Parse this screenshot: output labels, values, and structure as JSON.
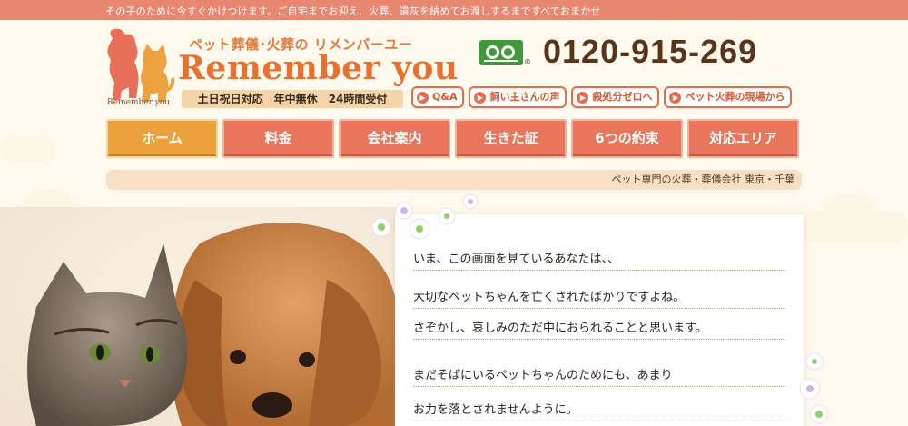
{
  "topbar": {
    "text": "その子のために今すぐかけつけます。ご自宅までお迎え、火葬、遺灰を納めてお渡しするまですべておまかせ"
  },
  "logo": {
    "caption": "Remember you",
    "tagline": "ペット葬儀･火葬の リメンバーユー",
    "brand": "Remember you",
    "hours": "土日祝日対応　年中無休　24時間受付"
  },
  "contact": {
    "phone": "0120-915-269",
    "registered_mark": "®",
    "freedial_icon": "freedial-icon"
  },
  "sublinks": [
    {
      "label": "Q&A"
    },
    {
      "label": "飼い主さんの声"
    },
    {
      "label": "殺処分ゼロへ"
    },
    {
      "label": "ペット火葬の現場から"
    }
  ],
  "nav": [
    {
      "label": "ホーム",
      "active": true
    },
    {
      "label": "料金"
    },
    {
      "label": "会社案内"
    },
    {
      "label": "生きた証"
    },
    {
      "label": "6つの約束"
    },
    {
      "label": "対応エリア"
    }
  ],
  "breadcrumb": {
    "text": "ペット専門の火葬・葬儀会社 東京・千葉"
  },
  "message": {
    "lines": [
      "いま、この画面を見ているあなたは、、",
      "大切なペットちゃんを亡くされたばかりですよね。",
      "さぞかし、哀しみのただ中におられることと思います。",
      "まだそばにいるペットちゃんのためにも、あまり",
      "お力を落とされませんように。"
    ]
  },
  "colors": {
    "accent": "#e9765a",
    "active_nav": "#eba23a",
    "brand": "#e8712f",
    "freedial_green": "#3f9a3a"
  }
}
